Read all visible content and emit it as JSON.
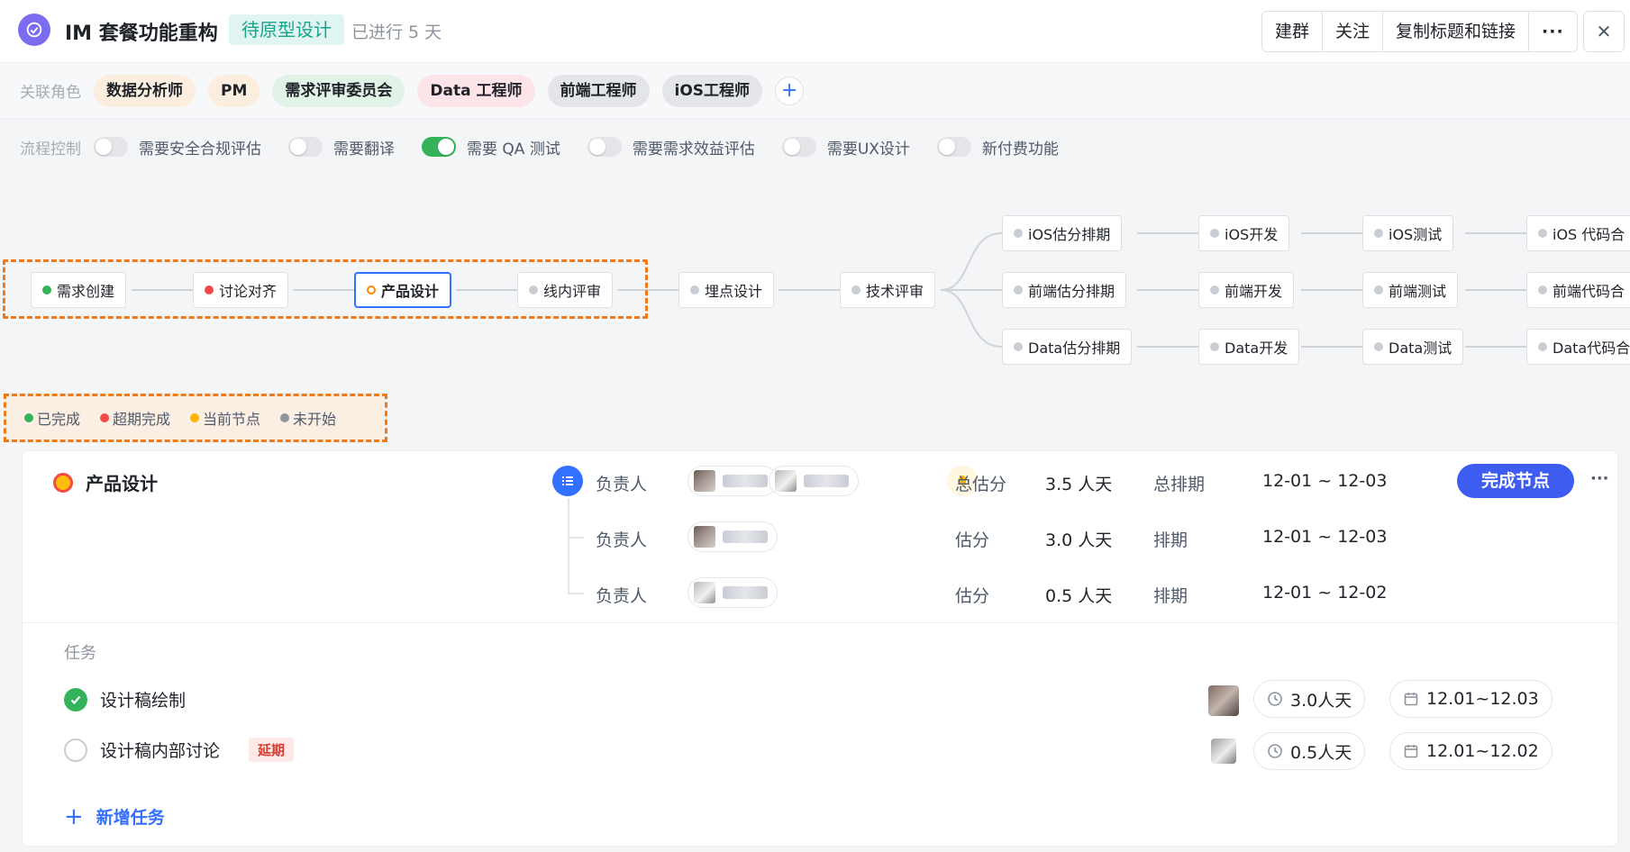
{
  "header": {
    "title": "IM 套餐功能重构",
    "status": "待原型设计",
    "days": "已进行 5 天",
    "actions": [
      "建群",
      "关注",
      "复制标题和链接",
      "···"
    ],
    "close_glyph": "✕"
  },
  "roles": {
    "label": "关联角色",
    "items": [
      {
        "name": "数据分析师",
        "color": "#fbeede"
      },
      {
        "name": "PM",
        "color": "#fbeede"
      },
      {
        "name": "需求评审委员会",
        "color": "#e1f2e6"
      },
      {
        "name": "Data 工程师",
        "color": "#fde4e9"
      },
      {
        "name": "前端工程师",
        "color": "#e3e5e8"
      },
      {
        "name": "iOS工程师",
        "color": "#e3e5e8"
      }
    ],
    "add_glyph": "+"
  },
  "process": {
    "label": "流程控制",
    "toggles": [
      {
        "label": "需要安全合规评估",
        "on": false
      },
      {
        "label": "需要翻译",
        "on": false
      },
      {
        "label": "需要 QA 测试",
        "on": true
      },
      {
        "label": "需要需求效益评估",
        "on": false
      },
      {
        "label": "需要UX设计",
        "on": false
      },
      {
        "label": "新付费功能",
        "on": false
      }
    ]
  },
  "flow": {
    "main": [
      "需求创建",
      "讨论对齐",
      "产品设计",
      "线内评审",
      "埋点设计",
      "技术评审"
    ],
    "branches": [
      [
        "iOS估分排期",
        "iOS开发",
        "iOS测试",
        "iOS 代码合"
      ],
      [
        "前端估分排期",
        "前端开发",
        "前端测试",
        "前端代码合"
      ],
      [
        "Data估分排期",
        "Data开发",
        "Data测试",
        "Data代码合"
      ]
    ]
  },
  "legend": {
    "items": [
      {
        "label": "已完成",
        "color": "#34b45a"
      },
      {
        "label": "超期完成",
        "color": "#f54a45"
      },
      {
        "label": "当前节点",
        "color": "#ffb400"
      },
      {
        "label": "未开始",
        "color": "#8f959e"
      }
    ]
  },
  "node_detail": {
    "title": "产品设计",
    "owner_label": "负责人",
    "total_est_label": "总估分",
    "total_est": "3.5 人天",
    "total_sched_label": "总排期",
    "total_sched": "12-01 ~ 12-03",
    "done_label": "完成节点",
    "more_glyph": "···",
    "sub": [
      {
        "owner_label": "负责人",
        "est_label": "估分",
        "est": "3.0 人天",
        "sched_label": "排期",
        "sched": "12-01 ~ 12-03"
      },
      {
        "owner_label": "负责人",
        "est_label": "估分",
        "est": "0.5 人天",
        "sched_label": "排期",
        "sched": "12-01 ~ 12-02"
      }
    ]
  },
  "tasks": {
    "label": "任务",
    "items": [
      {
        "name": "设计稿绘制",
        "done": true,
        "tag": "",
        "est": "3.0人天",
        "dates": "12.01~12.03"
      },
      {
        "name": "设计稿内部讨论",
        "done": false,
        "tag": "延期",
        "est": "0.5人天",
        "dates": "12.01~12.02"
      }
    ],
    "add_label": "新增任务",
    "add_glyph": "+"
  }
}
